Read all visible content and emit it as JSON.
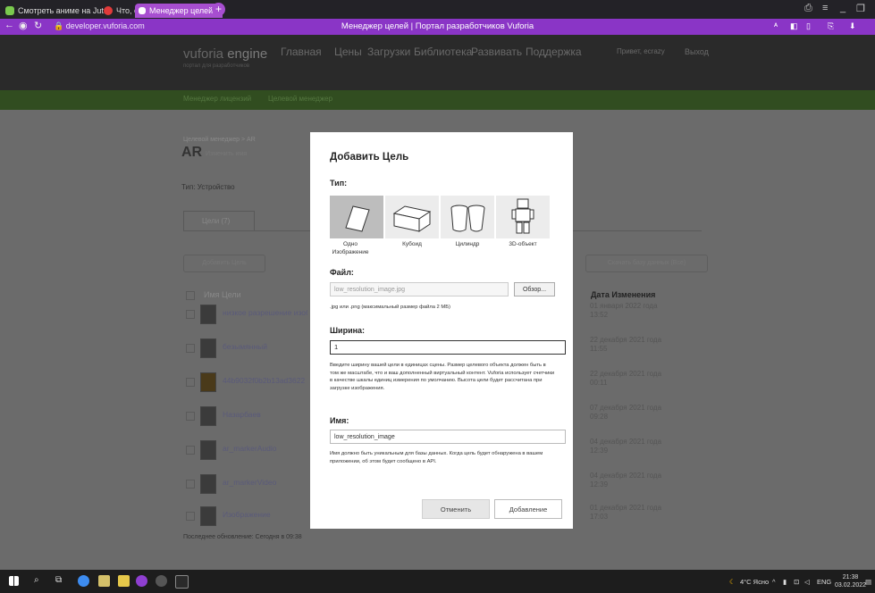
{
  "browser": {
    "tabs": [
      {
        "title": "Смотреть аниме на Jut.su",
        "color": "#7ac94e"
      },
      {
        "title": "Что, если...? / What If...?",
        "color": "#e03a3a"
      },
      {
        "title": "Менеджер целей | Пор",
        "color": "#ffffff",
        "close": "×"
      }
    ],
    "new_tab": "+",
    "url": "developer.vuforia.com",
    "page_title": "Менеджер целей | Портал разработчиков Vuforia"
  },
  "site": {
    "logo_main": "vuforia",
    "logo_engine": "engine",
    "logo_sub": "портал для разработчиков",
    "nav": [
      "Главная",
      "Цены",
      "Загрузки",
      "Библиотека",
      "Развивать",
      "Поддержка"
    ],
    "user": "Привет, ecrazy",
    "logout": "Выход",
    "subnav": [
      "Менеджер лицензий",
      "Целевой менеджер"
    ],
    "breadcrumb": "Целевой менеджер > AR",
    "db_name": "AR",
    "rename": "Изменить имя",
    "type_line": "Тип: Устройство",
    "targets_tab": "Цели (7)",
    "add_target": "Добавить Цель",
    "download_db": "Скачать базу данных (Все)",
    "col_name": "Имя Цели",
    "col_date": "Дата Изменения",
    "rows": [
      {
        "name": "низкое разрешение изобр",
        "date": "01 января 2022 года 13:52"
      },
      {
        "name": "безымянный",
        "date": "22 декабря 2021 года 11:55"
      },
      {
        "name": "44b9032f0b2b13ad3622",
        "date": "22 декабря 2021 года 00:11"
      },
      {
        "name": "Назарбаев",
        "date": "07 декабря 2021 года 09:28"
      },
      {
        "name": "ar_markerAudio",
        "date": "04 декабря 2021 года 12:39"
      },
      {
        "name": "ar_markerVideo",
        "date": "04 декабря 2021 года 12:39"
      },
      {
        "name": "Изображение",
        "date": "01 декабря 2021 года 17:03"
      }
    ],
    "last_update": "Последнее обновление: Сегодня в 09:38"
  },
  "modal": {
    "title": "Добавить Цель",
    "type_label": "Тип:",
    "types": [
      {
        "label": "Одно Изображение",
        "selected": true
      },
      {
        "label": "Кубоид",
        "selected": false
      },
      {
        "label": "Цилиндр",
        "selected": false
      },
      {
        "label": "3D-объект",
        "selected": false
      }
    ],
    "file_label": "Файл:",
    "file_value": "low_resolution_image.jpg",
    "browse": "Обзор...",
    "file_hint": ".jpg или .png (максимальный размер файла 2 МБ)",
    "width_label": "Ширина:",
    "width_value": "1",
    "width_hint": "Введите ширину вашей цели в единицах сцены. Размер целевого объекта должен быть в том же масштабе, что и ваш дополненный виртуальный контент. Vuforia использует счетчики в качестве шкалы единиц измерения по умолчанию. Высота цели будет рассчитана при загрузке изображения.",
    "name_label": "Имя:",
    "name_value": "low_resolution_image",
    "name_hint": "Имя должно быть уникальным для базы данных. Когда цель будет обнаружена в вашем приложении, об этом будет сообщено в API.",
    "cancel": "Отменить",
    "add": "Добавление"
  },
  "taskbar": {
    "weather": "4°C Ясно",
    "lang": "ENG",
    "time": "21:38",
    "date": "03.02.2022"
  }
}
